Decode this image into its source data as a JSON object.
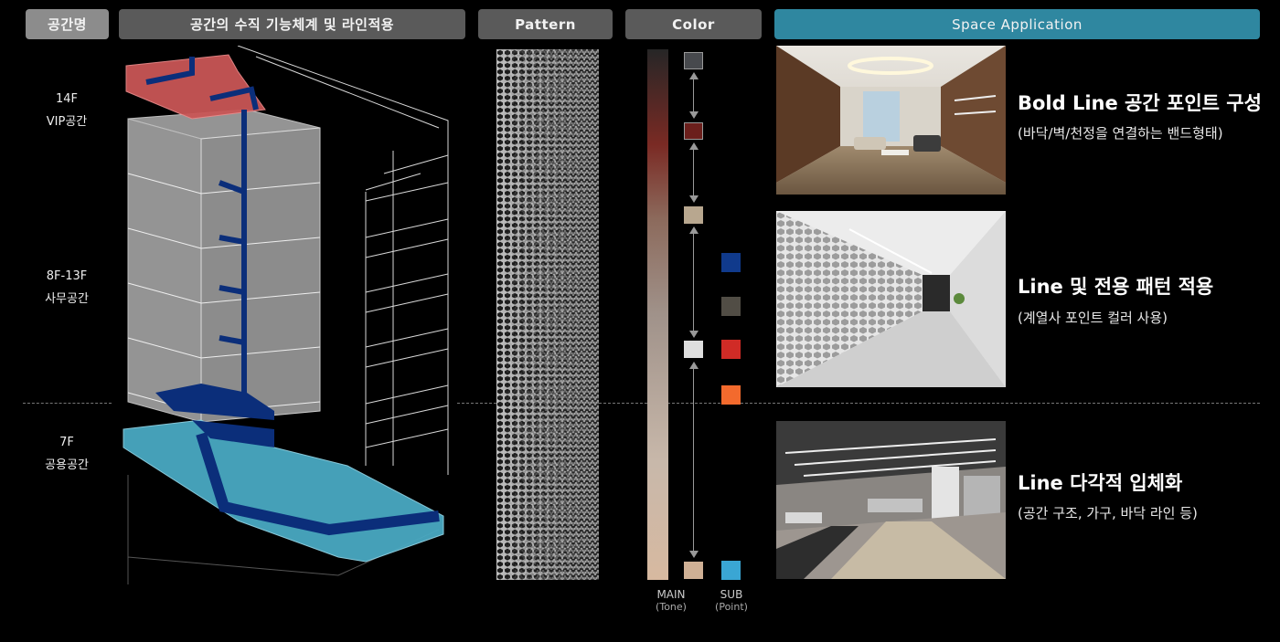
{
  "headers": {
    "space_name": "공간명",
    "vertical_system": "공간의 수직 기능체계 및 라인적용",
    "pattern": "Pattern",
    "color": "Color",
    "space_application": "Space Application"
  },
  "floors": [
    {
      "floor": "14F",
      "name": "VIP공간"
    },
    {
      "floor": "8F-13F",
      "name": "사무공간"
    },
    {
      "floor": "7F",
      "name": "공용공간"
    }
  ],
  "colors": {
    "main_tone": [
      "#47494d",
      "#6b1f1c",
      "#b8a78f",
      "#dedede",
      "#cfb095"
    ],
    "sub_point": [
      "#103a8c",
      "#514d45",
      "#d02b26",
      "#f36a2d",
      "#3aa6d4"
    ],
    "vip_zone": "#c95656",
    "common_zone": "#49a9c2",
    "line_blue": "#0b2e7a"
  },
  "legend": {
    "main": "MAIN",
    "main_sub": "(Tone)",
    "sub": "SUB",
    "sub_sub": "(Point)"
  },
  "applications": [
    {
      "title": "Bold Line 공간 포인트 구성",
      "desc": "(바닥/벽/천정을 연결하는 밴드형태)"
    },
    {
      "title": "Line 및 전용 패턴 적용",
      "desc": "(계열사 포인트 컬러 사용)"
    },
    {
      "title": "Line 다각적 입체화",
      "desc": "(공간 구조, 가구, 바닥 라인 등)"
    }
  ]
}
